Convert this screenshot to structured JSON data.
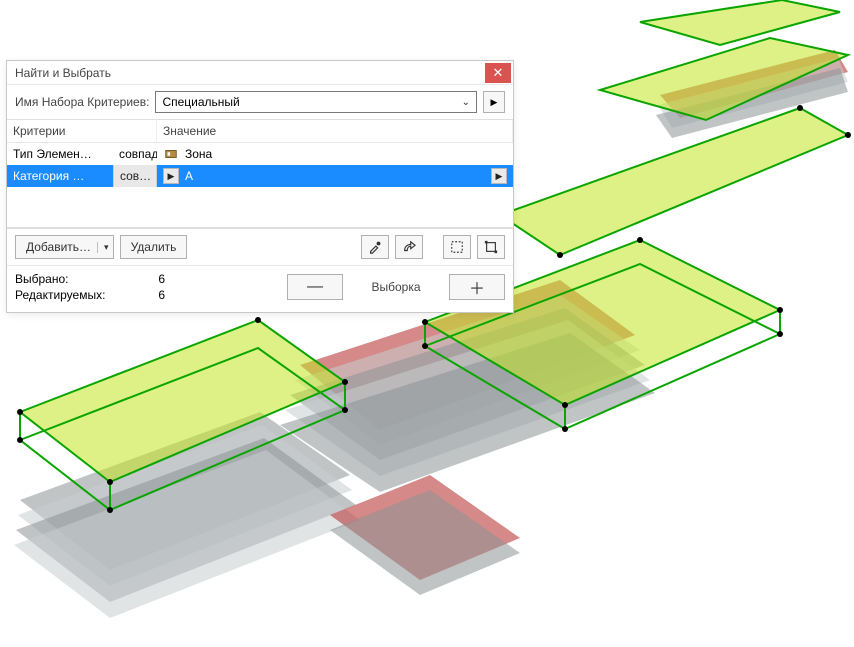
{
  "dialog": {
    "title": "Найти и Выбрать",
    "criteria_set_label": "Имя Набора Критериев:",
    "criteria_set_value": "Специальный",
    "grid": {
      "headers": {
        "criteria": "Критерии",
        "value": "Значение"
      },
      "rows": [
        {
          "criteria": "Тип Элемен…",
          "operator": "совпад…",
          "value": "Зона",
          "selected": false
        },
        {
          "criteria": "Категория …",
          "operator": "сов…",
          "value": "А",
          "selected": true
        }
      ]
    },
    "buttons": {
      "add": "Добавить…",
      "delete": "Удалить"
    },
    "status": {
      "selected_label": "Выбрано:",
      "selected_count": "6",
      "editable_label": "Редактируемых:",
      "editable_count": "6",
      "selection_label": "Выборка"
    }
  },
  "icons": {
    "close": "✕",
    "chevron_down": "⌄",
    "triangle_right": "▶",
    "triangle_down": "▾",
    "minus": "—",
    "plus": "＋"
  }
}
